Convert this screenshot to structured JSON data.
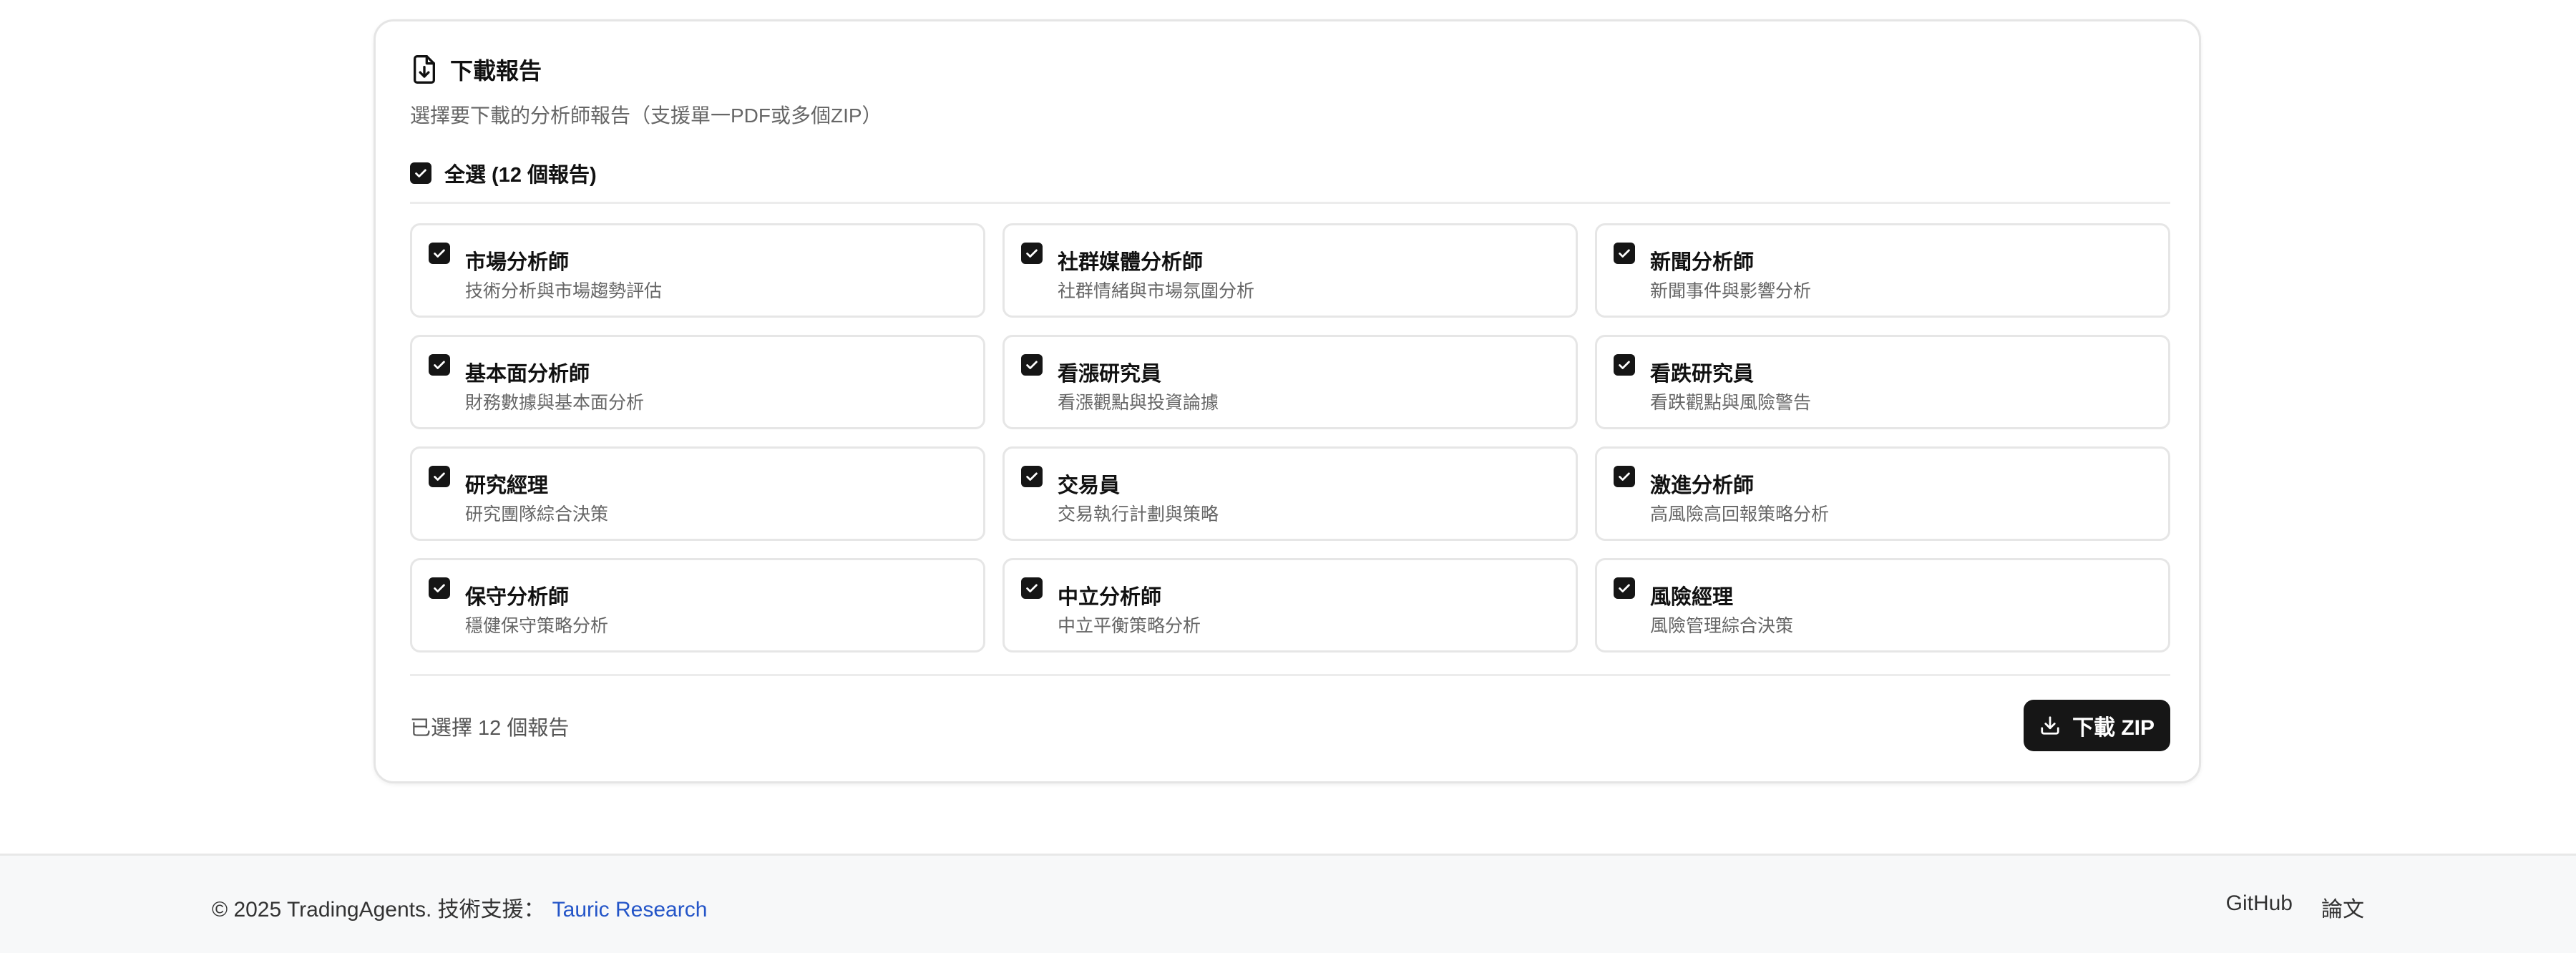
{
  "card": {
    "title": "下載報告",
    "description": "選擇要下載的分析師報告（支援單一PDF或多個ZIP）",
    "select_all_label": "全選 (12 個報告)",
    "reports": [
      {
        "name": "市場分析師",
        "desc": "技術分析與市場趨勢評估",
        "checked": true
      },
      {
        "name": "社群媒體分析師",
        "desc": "社群情緒與市場氛圍分析",
        "checked": true
      },
      {
        "name": "新聞分析師",
        "desc": "新聞事件與影響分析",
        "checked": true
      },
      {
        "name": "基本面分析師",
        "desc": "財務數據與基本面分析",
        "checked": true
      },
      {
        "name": "看漲研究員",
        "desc": "看漲觀點與投資論據",
        "checked": true
      },
      {
        "name": "看跌研究員",
        "desc": "看跌觀點與風險警告",
        "checked": true
      },
      {
        "name": "研究經理",
        "desc": "研究團隊綜合決策",
        "checked": true
      },
      {
        "name": "交易員",
        "desc": "交易執行計劃與策略",
        "checked": true
      },
      {
        "name": "激進分析師",
        "desc": "高風險高回報策略分析",
        "checked": true
      },
      {
        "name": "保守分析師",
        "desc": "穩健保守策略分析",
        "checked": true
      },
      {
        "name": "中立分析師",
        "desc": "中立平衡策略分析",
        "checked": true
      },
      {
        "name": "風險經理",
        "desc": "風險管理綜合決策",
        "checked": true
      }
    ],
    "selected_count_text": "已選擇 12 個報告",
    "download_button_label": "下載 ZIP"
  },
  "footer": {
    "copyright": "© 2025 TradingAgents. 技術支援：",
    "support_link": "Tauric Research",
    "links": [
      "GitHub",
      "論文"
    ]
  },
  "colors": {
    "checkbox": "#151515",
    "button_bg": "#161616",
    "link": "#2455c8",
    "footer_bg": "#f7f8f9"
  },
  "icons": {
    "title_icon": "file-download-icon",
    "checkbox_icon": "check-icon",
    "button_icon": "download-icon"
  }
}
